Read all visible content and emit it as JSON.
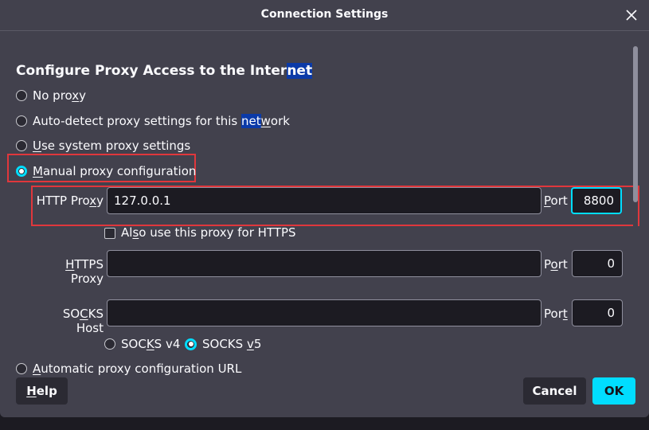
{
  "window": {
    "title": "Connection Settings"
  },
  "heading": {
    "before": "Configure Proxy Access to the Inter",
    "highlight": "net"
  },
  "proxy_options": {
    "no_proxy": {
      "pre": "No pro",
      "u": "x",
      "post": "y"
    },
    "auto_detect": {
      "pre": "Auto-detect proxy settings for this ",
      "hl": "net",
      "u": "w",
      "post": "ork"
    },
    "use_system": {
      "pre": "",
      "u": "U",
      "post": "se system proxy settings"
    },
    "manual": {
      "pre": "",
      "u": "M",
      "post": "anual proxy configuration"
    },
    "auto_url": {
      "pre": "",
      "u": "A",
      "post": "utomatic proxy configuration URL"
    }
  },
  "http_proxy": {
    "label_pre": "HTTP Pro",
    "label_u": "x",
    "label_post": "y",
    "value": "127.0.0.1",
    "port_label_pre": "",
    "port_label_u": "P",
    "port_label_post": "ort",
    "port_value": "8800"
  },
  "also_https": {
    "pre": "Al",
    "u": "s",
    "post": "o use this proxy for HTTPS"
  },
  "https_proxy": {
    "label_pre": "",
    "label_u": "H",
    "label_post": "TTPS Proxy",
    "value": "",
    "port_label_pre": "P",
    "port_label_u": "o",
    "port_label_post": "rt",
    "port_value": "0"
  },
  "socks_host": {
    "label_pre": "SO",
    "label_u": "C",
    "label_post": "KS Host",
    "value": "",
    "port_label_pre": "Por",
    "port_label_u": "t",
    "port_label_post": "",
    "port_value": "0"
  },
  "socks_version": {
    "v4": {
      "pre": "SOC",
      "u": "K",
      "post": "S v4"
    },
    "v5": {
      "pre": "SOCKS ",
      "u": "v",
      "post": "5"
    }
  },
  "buttons": {
    "help": {
      "pre": "",
      "u": "H",
      "post": "elp"
    },
    "cancel": "Cancel",
    "ok": "OK"
  },
  "colors": {
    "accent": "#00ddff",
    "highlight_box": "#e0373c",
    "selection": "#0b3aa8"
  }
}
